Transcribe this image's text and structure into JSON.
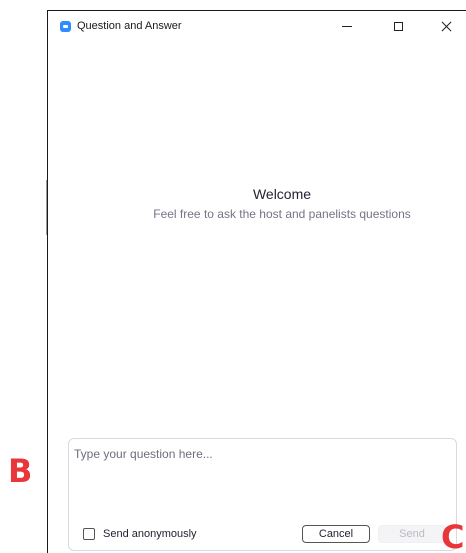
{
  "window": {
    "title": "Question and Answer",
    "icon": "zoom-app-icon",
    "accent": "#2d8cff"
  },
  "welcome": {
    "title": "Welcome",
    "subtitle": "Feel free to ask the host and panelists questions"
  },
  "compose": {
    "placeholder": "Type your question here...",
    "value": "",
    "anonymous_label": "Send anonymously",
    "anonymous_checked": false,
    "cancel_label": "Cancel",
    "send_label": "Send"
  },
  "annotations": {
    "b": "B",
    "c": "C",
    "color": "#e8363a"
  }
}
